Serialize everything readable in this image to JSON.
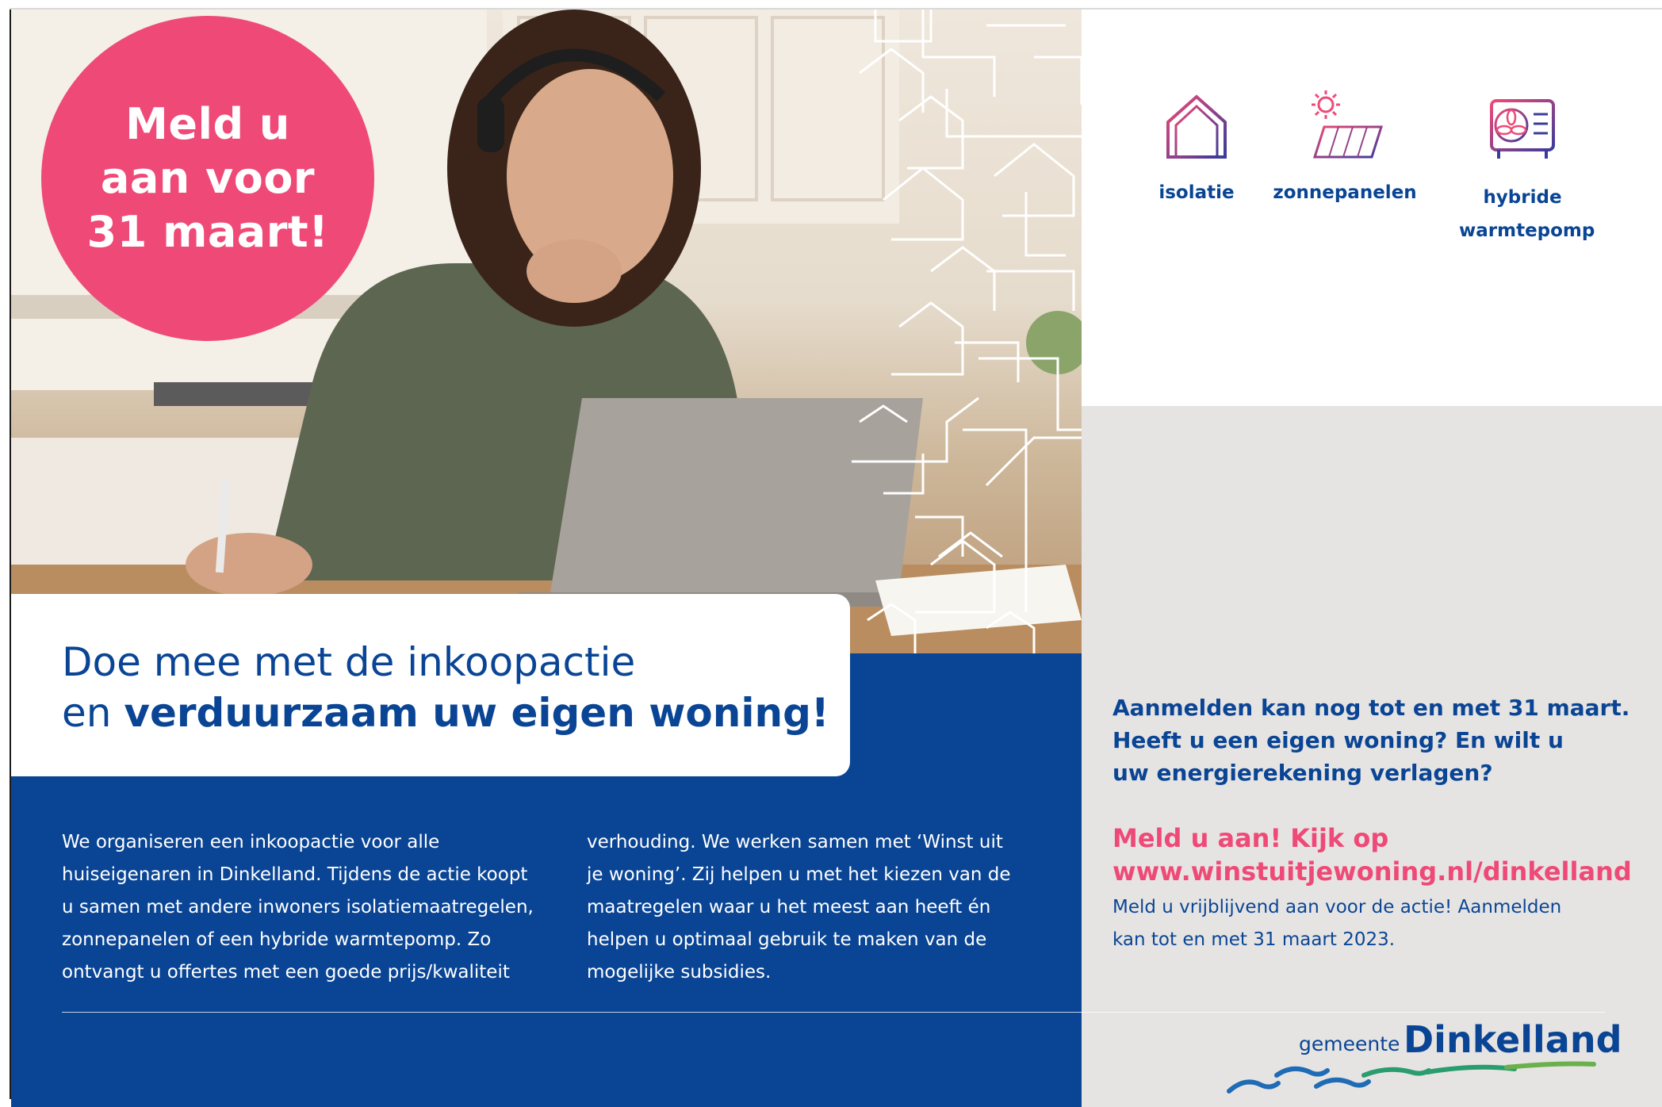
{
  "badge": {
    "line1": "Meld u",
    "line2": "aan voor",
    "line3": "31 maart!"
  },
  "headline": {
    "line1": "Doe mee met de inkoopactie",
    "line2_prefix": "en ",
    "line2_bold": "verduurzaam uw eigen woning!"
  },
  "icons": [
    {
      "icon": "house-insulation-icon",
      "label": "isolatie",
      "label2": ""
    },
    {
      "icon": "solar-panel-icon",
      "label": "zonnepanelen",
      "label2": ""
    },
    {
      "icon": "heat-pump-icon",
      "label": "hybride",
      "label2": "warmtepomp"
    }
  ],
  "body": {
    "col1": [
      "We organiseren een inkoopactie voor alle",
      "huiseigenaren in Dinkelland. Tijdens de actie koopt",
      "u samen met andere inwoners isolatiemaatregelen,",
      "zonnepanelen of een hybride warmtepomp. Zo",
      "ontvangt u offertes met een goede prijs/kwaliteit"
    ],
    "col2": [
      "verhouding. We werken samen met ‘Winst uit",
      "je woning’. Zij helpen u met het kiezen van de",
      "maatregelen waar u het meest aan heeft én",
      "helpen u optimaal gebruik te maken van de",
      "mogelijke subsidies."
    ]
  },
  "cta": {
    "question": [
      "Aanmelden kan nog tot en met 31 maart.",
      "Heeft u een eigen woning? En wilt u",
      "uw energierekening verlagen?"
    ],
    "call": "Meld u aan! Kijk op",
    "url": "www.winstuitjewoning.nl/dinkelland",
    "small": [
      "Meld u vrijblijvend aan voor de actie! Aanmelden",
      "kan tot en met 31 maart 2023."
    ]
  },
  "logo": {
    "prefix": "gemeente",
    "name": "Dinkelland"
  },
  "colors": {
    "blue": "#0a4595",
    "pink": "#ef4a77",
    "grey": "#e6e4e2",
    "icon_purple": "#7a3b8f"
  }
}
